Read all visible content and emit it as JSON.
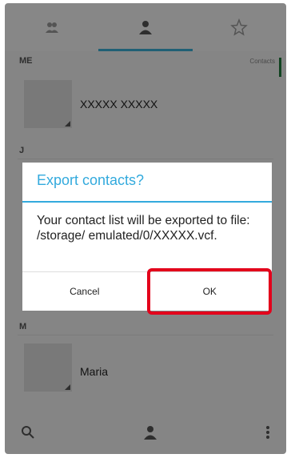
{
  "tabs": [
    {
      "name": "tab-groups",
      "icon": "group-icon"
    },
    {
      "name": "tab-contacts",
      "icon": "person-icon"
    },
    {
      "name": "tab-favorites",
      "icon": "star-icon"
    }
  ],
  "list": {
    "me_header": "ME",
    "contacts_count": "Contacts",
    "me_name": "XXXXX XXXXX",
    "section_j": "J",
    "section_m": "M",
    "maria_name": "Maria"
  },
  "dialog": {
    "title": "Export contacts?",
    "message": "Your contact list will be exported to file: /storage/ emulated/0/XXXXX.vcf.",
    "cancel_label": "Cancel",
    "ok_label": "OK"
  },
  "colors": {
    "accent": "#33aadd",
    "highlight": "#e3001b"
  }
}
